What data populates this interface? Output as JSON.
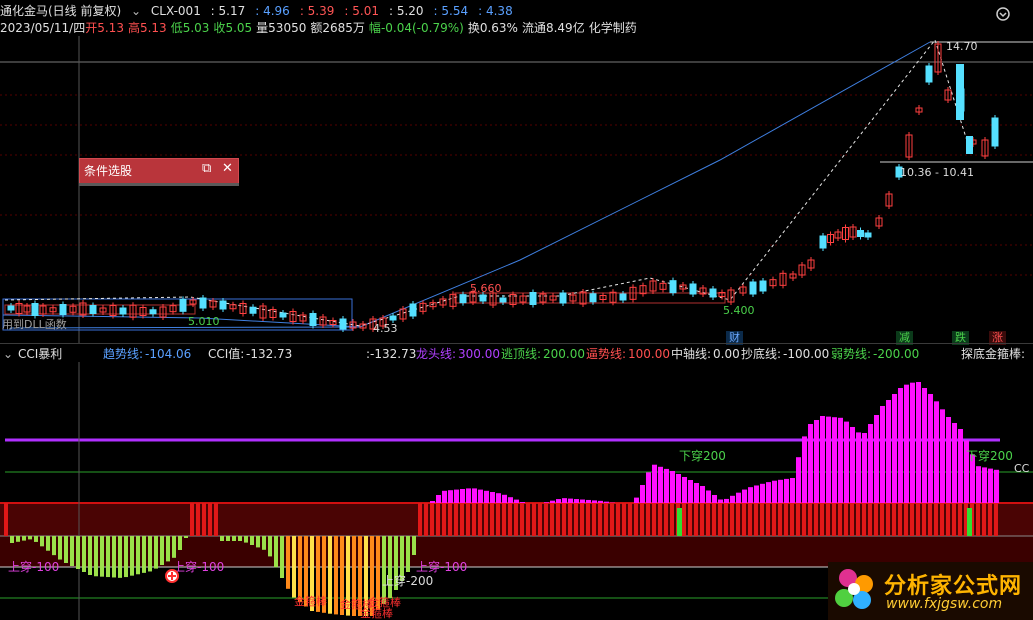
{
  "header": {
    "stock_name": "通化金马(日线 前复权)",
    "indicator_name": "CLX-001",
    "values": [
      "5.17",
      "4.96",
      "5.39",
      "5.01",
      "5.20",
      "5.54",
      "4.38"
    ],
    "value_colors": [
      "#e0e0e0",
      "#5aa0ff",
      "#ff5555",
      "#ff5555",
      "#e0e0e0",
      "#5aa0ff",
      "#5aa0ff"
    ]
  },
  "info": {
    "date": "2023/05/11/四",
    "open_label": "开",
    "open": "5.13",
    "high_label": "高",
    "high": "5.13",
    "low_label": "低",
    "low": "5.03",
    "close_label": "收",
    "close": "5.05",
    "volume_label": "量",
    "volume": "53050",
    "amount_label": "额",
    "amount": "2685万",
    "change_label": "幅",
    "change": "-0.04(-0.79%)",
    "turnover_label": "换",
    "turnover": "0.63%",
    "float_label": "流通",
    "float": "8.49亿",
    "sector": "化学制药"
  },
  "dialog": {
    "title": "条件选股"
  },
  "price_labels": {
    "high": "14.70",
    "range": "10.36 - 10.41",
    "p5660": "5.660",
    "p5010": "5.010",
    "p5400": "5.400",
    "p453": "4.53",
    "dll_note": "用到DLL函数"
  },
  "flags": {
    "cai": "财",
    "jian": "减",
    "die": "跌",
    "zhang": "涨"
  },
  "cci": {
    "name": "CCI暴利",
    "trend_label": "趋势线:",
    "trend_value": "-104.06",
    "cci_label": "CCI值:",
    "cci_value": "-132.73",
    "extra_value": ":-132.73",
    "dragon_label": "龙头线:",
    "dragon_value": "300.00",
    "escape_label": "逃顶线:",
    "escape_value": "200.00",
    "press_label": "逼势线:",
    "press_value": "100.00",
    "axis_label": "中轴线:",
    "axis_value": "0.00",
    "bottom_label": "抄底线:",
    "bottom_value": "-100.00",
    "weak_label": "弱势线:",
    "weak_value": "-200.00",
    "hoop_label": "探底金箍棒:",
    "annotations": {
      "down200_a": "下穿200",
      "down200_b": "下穿200",
      "up100_a": "上穿-100",
      "up100_b": "上穿-100",
      "up100_c": "上穿-100",
      "up200": "上穿-200",
      "hoop_1": "金箍棒",
      "hoop_2": "金箍棒",
      "hoop_3": "金箍棒",
      "hoop_4": "金箍棒",
      "cc_tag": "CC"
    }
  },
  "logo": {
    "name": "分析家公式网",
    "url": "www.fxjgsw.com"
  }
}
